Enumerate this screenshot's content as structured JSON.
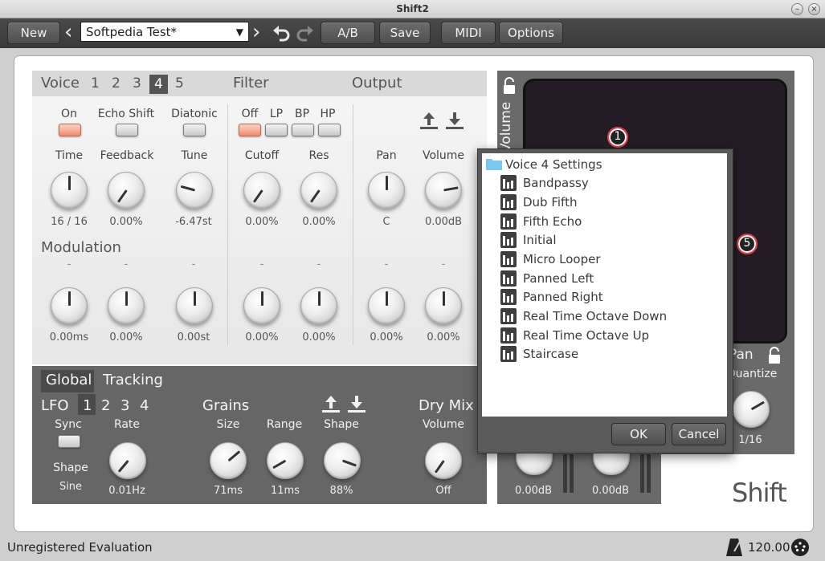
{
  "window": {
    "title": "Shift2"
  },
  "toolbar": {
    "new_label": "New",
    "preset_value": "Softpedia Test*",
    "ab_label": "A/B",
    "save_label": "Save",
    "midi_label": "MIDI",
    "options_label": "Options"
  },
  "voice": {
    "header": "Voice",
    "numbers": [
      "1",
      "2",
      "3",
      "4",
      "5"
    ],
    "selected": "4",
    "filter_header": "Filter",
    "output_header": "Output",
    "toggles": [
      "On",
      "Echo Shift",
      "Diatonic"
    ],
    "filter_modes": [
      "Off",
      "LP",
      "BP",
      "HP"
    ],
    "knob_labels": [
      "Time",
      "Feedback",
      "Tune",
      "Cutoff",
      "Res",
      "Pan",
      "Volume"
    ],
    "knob_values": [
      "16 / 16",
      "0.00%",
      "-6.47st",
      "0.00%",
      "0.00%",
      "C",
      "0.00dB"
    ],
    "modulation_header": "Modulation",
    "mod_dash": "-",
    "mod_values": [
      "0.00ms",
      "0.00%",
      "0.00st",
      "0.00%",
      "0.00%",
      "0.00%",
      "0.00%"
    ]
  },
  "global": {
    "tab_global": "Global",
    "tab_tracking": "Tracking",
    "lfo_label": "LFO",
    "lfo_numbers": [
      "1",
      "2",
      "3",
      "4"
    ],
    "lfo_selected": "1",
    "sync_label": "Sync",
    "rate_label": "Rate",
    "shape_label": "Shape",
    "shape_value": "Sine",
    "rate_value": "0.01Hz",
    "grains_label": "Grains",
    "size_label": "Size",
    "range_label": "Range",
    "gshape_label": "Shape",
    "size_value": "71ms",
    "range_value": "11ms",
    "gshape_value": "88%",
    "drymix_label": "Dry Mix",
    "drymix_volume_label": "Volume",
    "drymix_value": "Off"
  },
  "xypad": {
    "volume_axis": "Volume",
    "pan_axis": "Pan",
    "quantize_label": "Quantize",
    "quantize_value": "1/16",
    "nodes": [
      "1",
      "5"
    ],
    "out_values": [
      "0.00dB",
      "0.00dB"
    ]
  },
  "dialog": {
    "root": "Voice 4 Settings",
    "items": [
      "Bandpassy",
      "Dub Fifth",
      "Fifth Echo",
      "Initial",
      "Micro Looper",
      "Panned Left",
      "Panned Right",
      "Real Time Octave Down",
      "Real Time Octave Up",
      "Staircase"
    ],
    "ok_label": "OK",
    "cancel_label": "Cancel"
  },
  "status": {
    "left_text": "Unregistered Evaluation",
    "tempo": "120.00"
  },
  "logo": "Shift",
  "colors": {
    "accent_led": "#f08a70",
    "xy_node": "#e04050"
  }
}
